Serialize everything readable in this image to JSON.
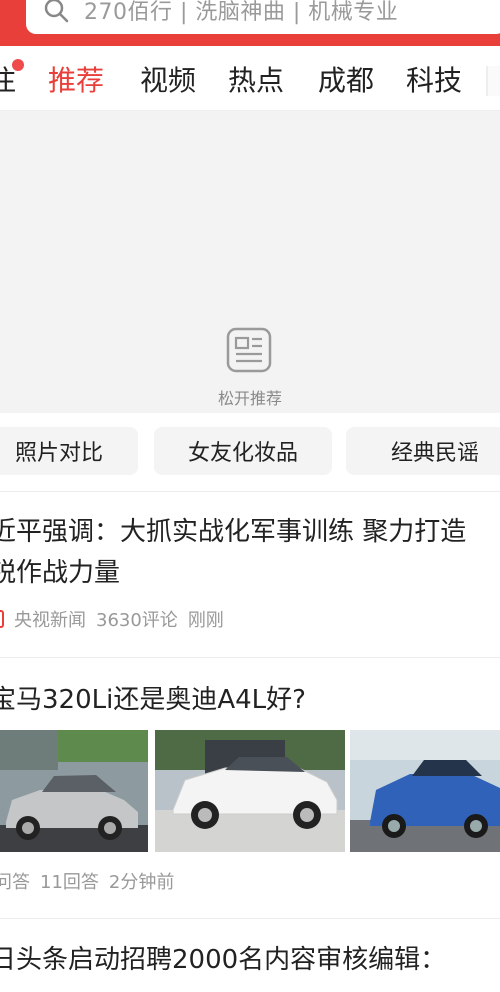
{
  "search": {
    "query": "270佰行 | 洗脑神曲 | 机械专业",
    "icon": "search-icon"
  },
  "tabs": [
    {
      "label": "注",
      "active": false
    },
    {
      "label": "推荐",
      "active": true
    },
    {
      "label": "视频",
      "active": false
    },
    {
      "label": "热点",
      "active": false
    },
    {
      "label": "成都",
      "active": false
    },
    {
      "label": "科技",
      "active": false
    }
  ],
  "refresh": {
    "hint": "松开推荐",
    "icon": "news-icon"
  },
  "chips": [
    "照片对比",
    "女友化妆品",
    "经典民谣"
  ],
  "articles": [
    {
      "title_line1": "近平强调：大抓实战化军事训练 聚力打造",
      "title_line2": "锐作战力量",
      "source": "央视新闻",
      "comments": "3630评论",
      "time": "刚刚"
    },
    {
      "title_line1": "宝马320Li还是奥迪A4L好?",
      "source": "问答",
      "comments": "11回答",
      "time": "2分钟前",
      "images": [
        "silver-audi-sedan",
        "white-bmw-sedan",
        "blue-bmw-sedan"
      ]
    },
    {
      "title_line1": "日头条启动招聘2000名内容审核编辑："
    }
  ],
  "colors": {
    "accent": "#e93f3b",
    "text": "#222222",
    "muted": "#999999",
    "pull_bg": "#f3f3f3"
  }
}
